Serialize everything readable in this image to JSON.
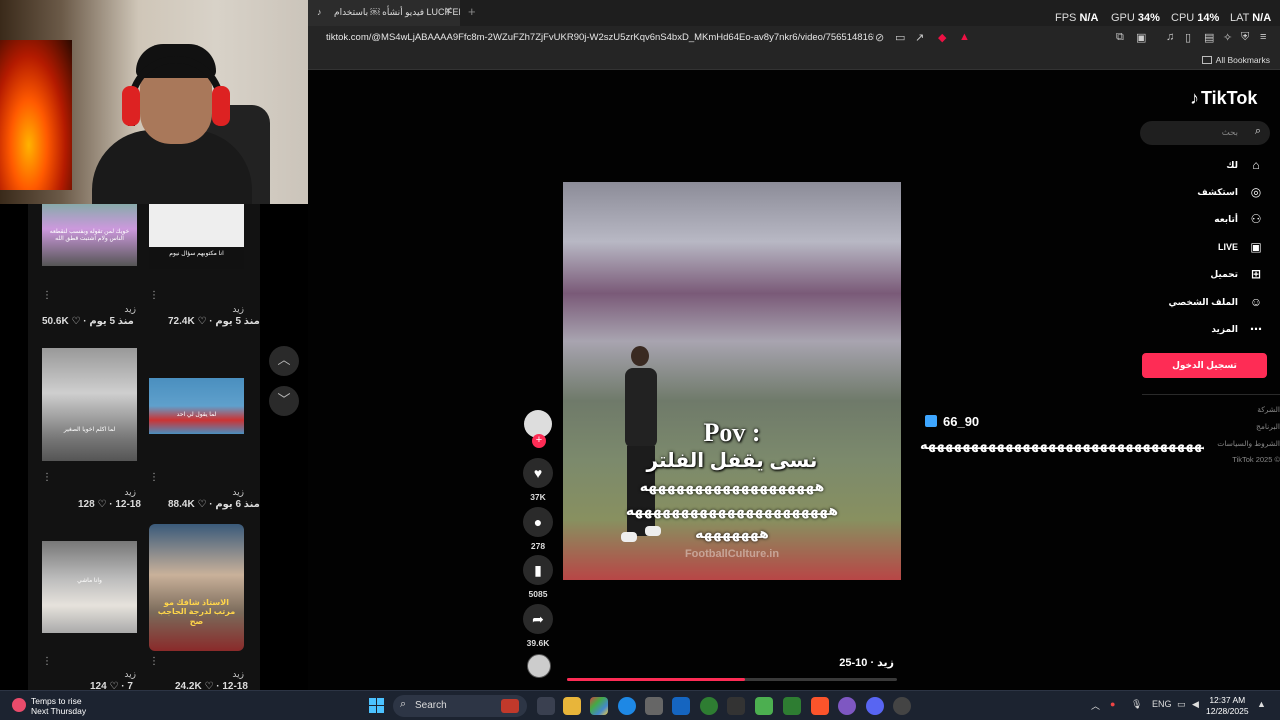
{
  "browser": {
    "tab_title": "فيديو أنشأه ￼ باستخدام LUCIFER",
    "url": "tiktok.com/@MS4wLjABAAAA9Ffc8m-2WZuFZh7ZjFvUKR90j-W2szU5zrKqv6nS4bxD_MKmHd64Eo-av8y7nkr6/video/756514816544435739...",
    "bookmarks_label": "All Bookmarks",
    "perf": {
      "fps_label": "FPS",
      "fps_value": "N/A",
      "gpu_label": "GPU",
      "gpu_value": "34",
      "cpu_label": "CPU",
      "cpu_value": "14",
      "lat_label": "LAT",
      "lat_value": "N/A",
      "pct": "%"
    }
  },
  "left_grid": {
    "rows": [
      [
        {
          "author": "زيد",
          "stats": "50.6K ♡ · منذ 5 يوم",
          "caption": "خويك لمن تقوله وبفسب لنقطعه الناس ولام اشتبت قطق الله"
        },
        {
          "author": "زيد",
          "stats": "72.4K ♡ · منذ 5 يوم",
          "caption": "انا مكتوبهم سؤال نيوم"
        }
      ],
      [
        {
          "author": "زيد",
          "stats": "128 ♡ · 12-18",
          "caption": "لما اكلم اخويا الصغير"
        },
        {
          "author": "زيد",
          "stats": "88.4K ♡ · منذ 6 يوم",
          "caption": "لما يقول لي احد"
        }
      ],
      [
        {
          "author": "زيد",
          "stats": "124 ♡ · 7",
          "caption": "وانا ماشي"
        },
        {
          "author": "زيد",
          "stats": "24.2K ♡ · 12-18",
          "caption": "الاستاذ شافك مو مرتب لدرجة الحاجب صح"
        }
      ]
    ]
  },
  "video": {
    "pov_title": "Pov :",
    "pov_subtitle": "نسى يقفل الفلتر",
    "haha_line1": "هههههههههههههههههههه",
    "haha_line2": "ههههههههههههههههههههههه",
    "haha_line3": "هههههههه",
    "watermark": "FootballCulture.in",
    "caption": "زيد · 10-25",
    "progress": 0.54,
    "actions": {
      "likes": "37K",
      "comments": "278",
      "saves": "5085",
      "shares": "39.6K"
    }
  },
  "overlay": {
    "username": "66_90",
    "long_text": "هههههههههههههههههههههههههههههههههههههههههههههههههههههههههههههههههههههههههههههههههههه"
  },
  "tiktok_nav": {
    "logo": "TikTok",
    "search_placeholder": "بحث",
    "items": [
      {
        "label": "لك",
        "icon": "home-icon"
      },
      {
        "label": "استكشف",
        "icon": "compass-icon"
      },
      {
        "label": "أتابعه",
        "icon": "following-icon"
      },
      {
        "label": "LIVE",
        "icon": "live-icon"
      },
      {
        "label": "تحميل",
        "icon": "upload-icon"
      },
      {
        "label": "الملف الشخصي",
        "icon": "profile-icon"
      },
      {
        "label": "المزيد",
        "icon": "more-icon"
      }
    ],
    "login_label": "تسجيل الدخول",
    "footer": [
      "الشركة",
      "البرنامج",
      "الشروط والسياسات",
      "TikTok 2025 ©"
    ]
  },
  "taskbar": {
    "weather_line1": "Temps to rise",
    "weather_line2": "Next Thursday",
    "search_label": "Search",
    "lang": "ENG",
    "time": "12:37 AM",
    "date": "12/28/2025"
  },
  "colors": {
    "accent": "#fe2c55",
    "taskbar": "#1c2330"
  }
}
